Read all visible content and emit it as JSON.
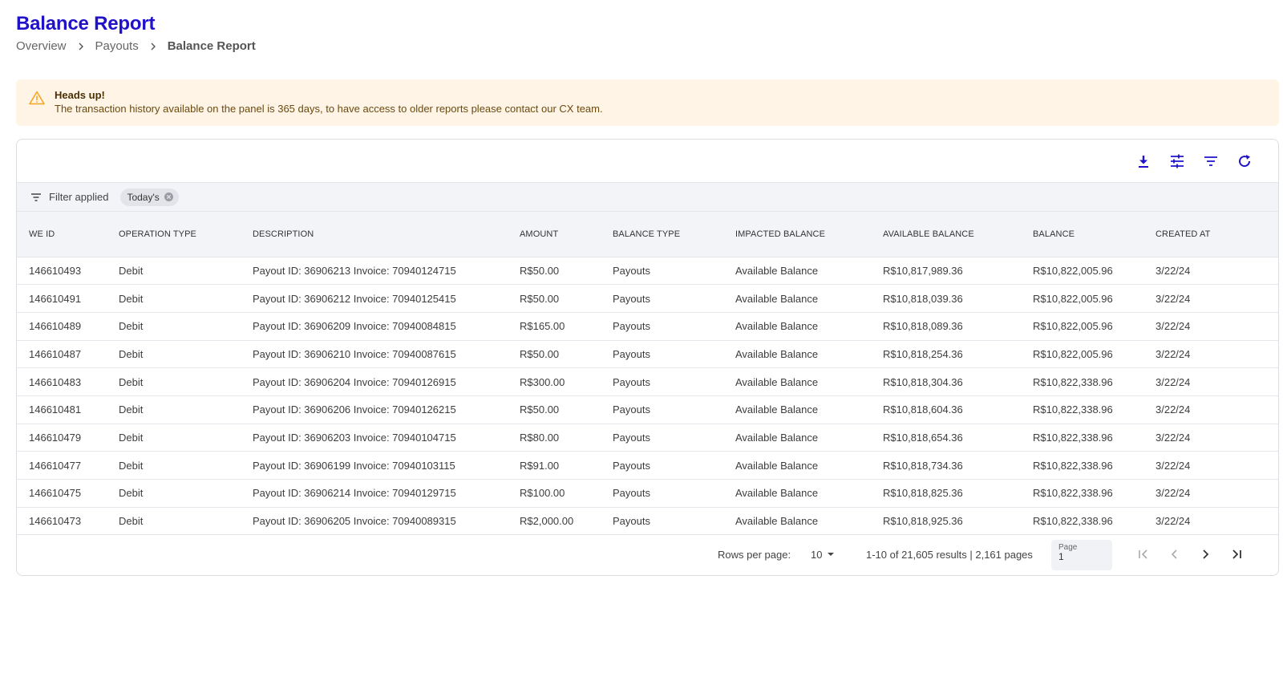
{
  "header": {
    "title": "Balance Report",
    "breadcrumb": [
      "Overview",
      "Payouts",
      "Balance Report"
    ]
  },
  "alert": {
    "title": "Heads up!",
    "message": "The transaction history available on the panel is 365 days, to have access to older reports please contact our CX team.",
    "icon": "warning-triangle-icon",
    "color": "#f5a623"
  },
  "toolbar": {
    "icons": [
      "download-icon",
      "columns-settings-icon",
      "filter-icon",
      "refresh-icon"
    ],
    "accent": "#1f12c9"
  },
  "filter": {
    "label": "Filter applied",
    "chip": "Today's"
  },
  "table": {
    "columns": [
      "WE ID",
      "OPERATION TYPE",
      "DESCRIPTION",
      "AMOUNT",
      "BALANCE TYPE",
      "IMPACTED BALANCE",
      "AVAILABLE BALANCE",
      "BALANCE",
      "CREATED AT"
    ],
    "rows": [
      [
        "146610493",
        "Debit",
        "Payout ID: 36906213 Invoice: 70940124715",
        "R$50.00",
        "Payouts",
        "Available Balance",
        "R$10,817,989.36",
        "R$10,822,005.96",
        "3/22/24"
      ],
      [
        "146610491",
        "Debit",
        "Payout ID: 36906212 Invoice: 70940125415",
        "R$50.00",
        "Payouts",
        "Available Balance",
        "R$10,818,039.36",
        "R$10,822,005.96",
        "3/22/24"
      ],
      [
        "146610489",
        "Debit",
        "Payout ID: 36906209 Invoice: 70940084815",
        "R$165.00",
        "Payouts",
        "Available Balance",
        "R$10,818,089.36",
        "R$10,822,005.96",
        "3/22/24"
      ],
      [
        "146610487",
        "Debit",
        "Payout ID: 36906210 Invoice: 70940087615",
        "R$50.00",
        "Payouts",
        "Available Balance",
        "R$10,818,254.36",
        "R$10,822,005.96",
        "3/22/24"
      ],
      [
        "146610483",
        "Debit",
        "Payout ID: 36906204 Invoice: 70940126915",
        "R$300.00",
        "Payouts",
        "Available Balance",
        "R$10,818,304.36",
        "R$10,822,338.96",
        "3/22/24"
      ],
      [
        "146610481",
        "Debit",
        "Payout ID: 36906206 Invoice: 70940126215",
        "R$50.00",
        "Payouts",
        "Available Balance",
        "R$10,818,604.36",
        "R$10,822,338.96",
        "3/22/24"
      ],
      [
        "146610479",
        "Debit",
        "Payout ID: 36906203 Invoice: 70940104715",
        "R$80.00",
        "Payouts",
        "Available Balance",
        "R$10,818,654.36",
        "R$10,822,338.96",
        "3/22/24"
      ],
      [
        "146610477",
        "Debit",
        "Payout ID: 36906199 Invoice: 70940103115",
        "R$91.00",
        "Payouts",
        "Available Balance",
        "R$10,818,734.36",
        "R$10,822,338.96",
        "3/22/24"
      ],
      [
        "146610475",
        "Debit",
        "Payout ID: 36906214 Invoice: 70940129715",
        "R$100.00",
        "Payouts",
        "Available Balance",
        "R$10,818,825.36",
        "R$10,822,338.96",
        "3/22/24"
      ],
      [
        "146610473",
        "Debit",
        "Payout ID: 36906205 Invoice: 70940089315",
        "R$2,000.00",
        "Payouts",
        "Available Balance",
        "R$10,818,925.36",
        "R$10,822,338.96",
        "3/22/24"
      ]
    ]
  },
  "pagination": {
    "rows_per_page_label": "Rows per page:",
    "rows_per_page_value": "10",
    "range_text": "1-10 of 21,605 results | 2,161 pages",
    "page_label": "Page",
    "page_value": "1"
  }
}
